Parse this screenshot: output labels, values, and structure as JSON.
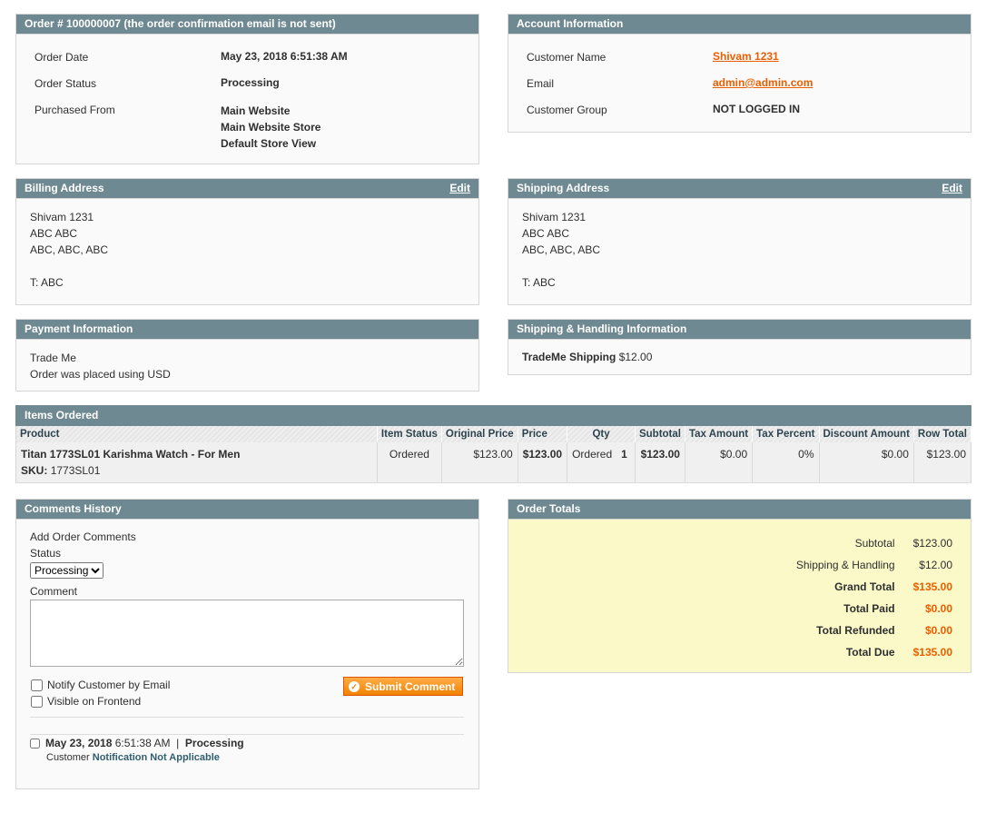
{
  "order": {
    "header": "Order # 100000007 (the order confirmation email is not sent)",
    "date_label": "Order Date",
    "date_value": "May 23, 2018 6:51:38 AM",
    "status_label": "Order Status",
    "status_value": "Processing",
    "purchased_label": "Purchased From",
    "purchased_lines": [
      "Main Website",
      "Main Website Store",
      "Default Store View"
    ]
  },
  "account": {
    "header": "Account Information",
    "name_label": "Customer Name",
    "name_value": "Shivam 1231",
    "email_label": "Email",
    "email_value": "admin@admin.com",
    "group_label": "Customer Group",
    "group_value": "NOT LOGGED IN"
  },
  "billing": {
    "header": "Billing Address",
    "edit": "Edit",
    "lines": [
      "Shivam 1231",
      "ABC ABC",
      "ABC, ABC, ABC",
      "",
      "T: ABC"
    ]
  },
  "shipping": {
    "header": "Shipping Address",
    "edit": "Edit",
    "lines": [
      "Shivam 1231",
      "ABC ABC",
      "ABC, ABC, ABC",
      "",
      "T: ABC"
    ]
  },
  "payment": {
    "header": "Payment Information",
    "method": "Trade Me",
    "currency_note": "Order was placed using USD"
  },
  "shipping_handling": {
    "header": "Shipping & Handling Information",
    "method": "TradeMe Shipping",
    "price": "$12.00"
  },
  "items": {
    "header": "Items Ordered",
    "columns": [
      "Product",
      "Item Status",
      "Original Price",
      "Price",
      "Qty",
      "Subtotal",
      "Tax Amount",
      "Tax Percent",
      "Discount Amount",
      "Row Total"
    ],
    "row": {
      "product_name": "Titan 1773SL01 Karishma Watch - For Men",
      "sku_label": "SKU:",
      "sku_value": "1773SL01",
      "item_status": "Ordered",
      "original_price": "$123.00",
      "price": "$123.00",
      "qty_label": "Ordered",
      "qty_value": "1",
      "subtotal": "$123.00",
      "tax_amount": "$0.00",
      "tax_percent": "0%",
      "discount": "$0.00",
      "row_total": "$123.00"
    }
  },
  "comments": {
    "header": "Comments History",
    "add_label": "Add Order Comments",
    "status_label": "Status",
    "status_selected": "Processing",
    "comment_label": "Comment",
    "comment_value": "",
    "notify_label": "Notify Customer by Email",
    "visible_label": "Visible on Frontend",
    "submit_label": "Submit Comment",
    "history": {
      "date": "May 23, 2018",
      "time": "6:51:38 AM",
      "separator": "|",
      "status": "Processing",
      "customer_label": "Customer",
      "notification": "Notification Not Applicable"
    }
  },
  "totals": {
    "header": "Order Totals",
    "rows": [
      {
        "label": "Subtotal",
        "value": "$123.00"
      },
      {
        "label": "Shipping & Handling",
        "value": "$12.00"
      },
      {
        "label": "Grand Total",
        "value": "$135.00"
      },
      {
        "label": "Total Paid",
        "value": "$0.00"
      },
      {
        "label": "Total Refunded",
        "value": "$0.00"
      },
      {
        "label": "Total Due",
        "value": "$135.00"
      }
    ]
  },
  "colors": {
    "header_bg": "#6f8992",
    "accent_orange": "#eb5e00",
    "totals_bg": "#fbf9c8"
  }
}
